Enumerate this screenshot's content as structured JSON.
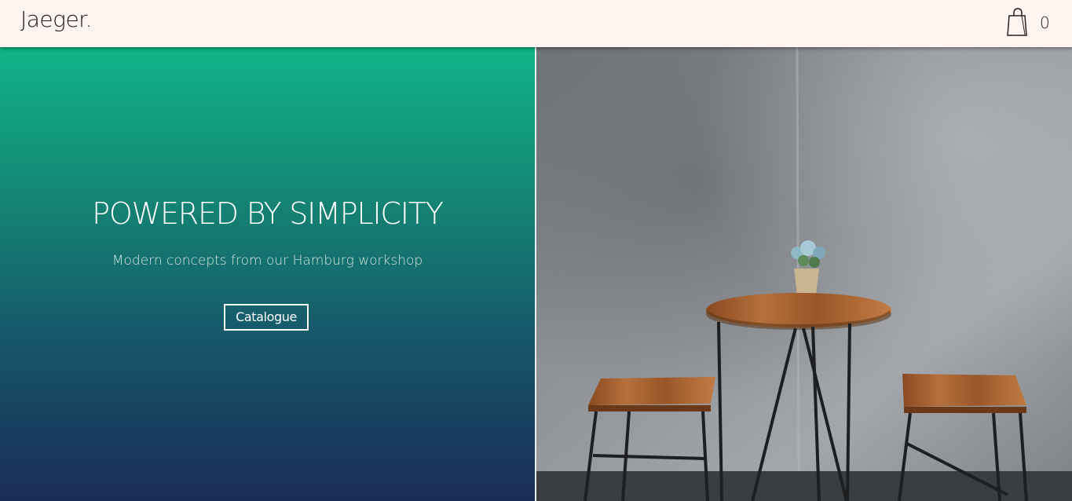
{
  "header": {
    "logo": "Jaeger.",
    "cart_icon": "shopping-bag-icon",
    "cart_count": "0"
  },
  "hero": {
    "title": "POWERED BY SIMPLICITY",
    "subtitle": "Modern concepts from our Hamburg workshop",
    "button_label": "Catalogue",
    "gradient": [
      "#10b489",
      "#148473",
      "#16546a",
      "#1a2c55"
    ],
    "photo": "table-and-stools-photo"
  }
}
